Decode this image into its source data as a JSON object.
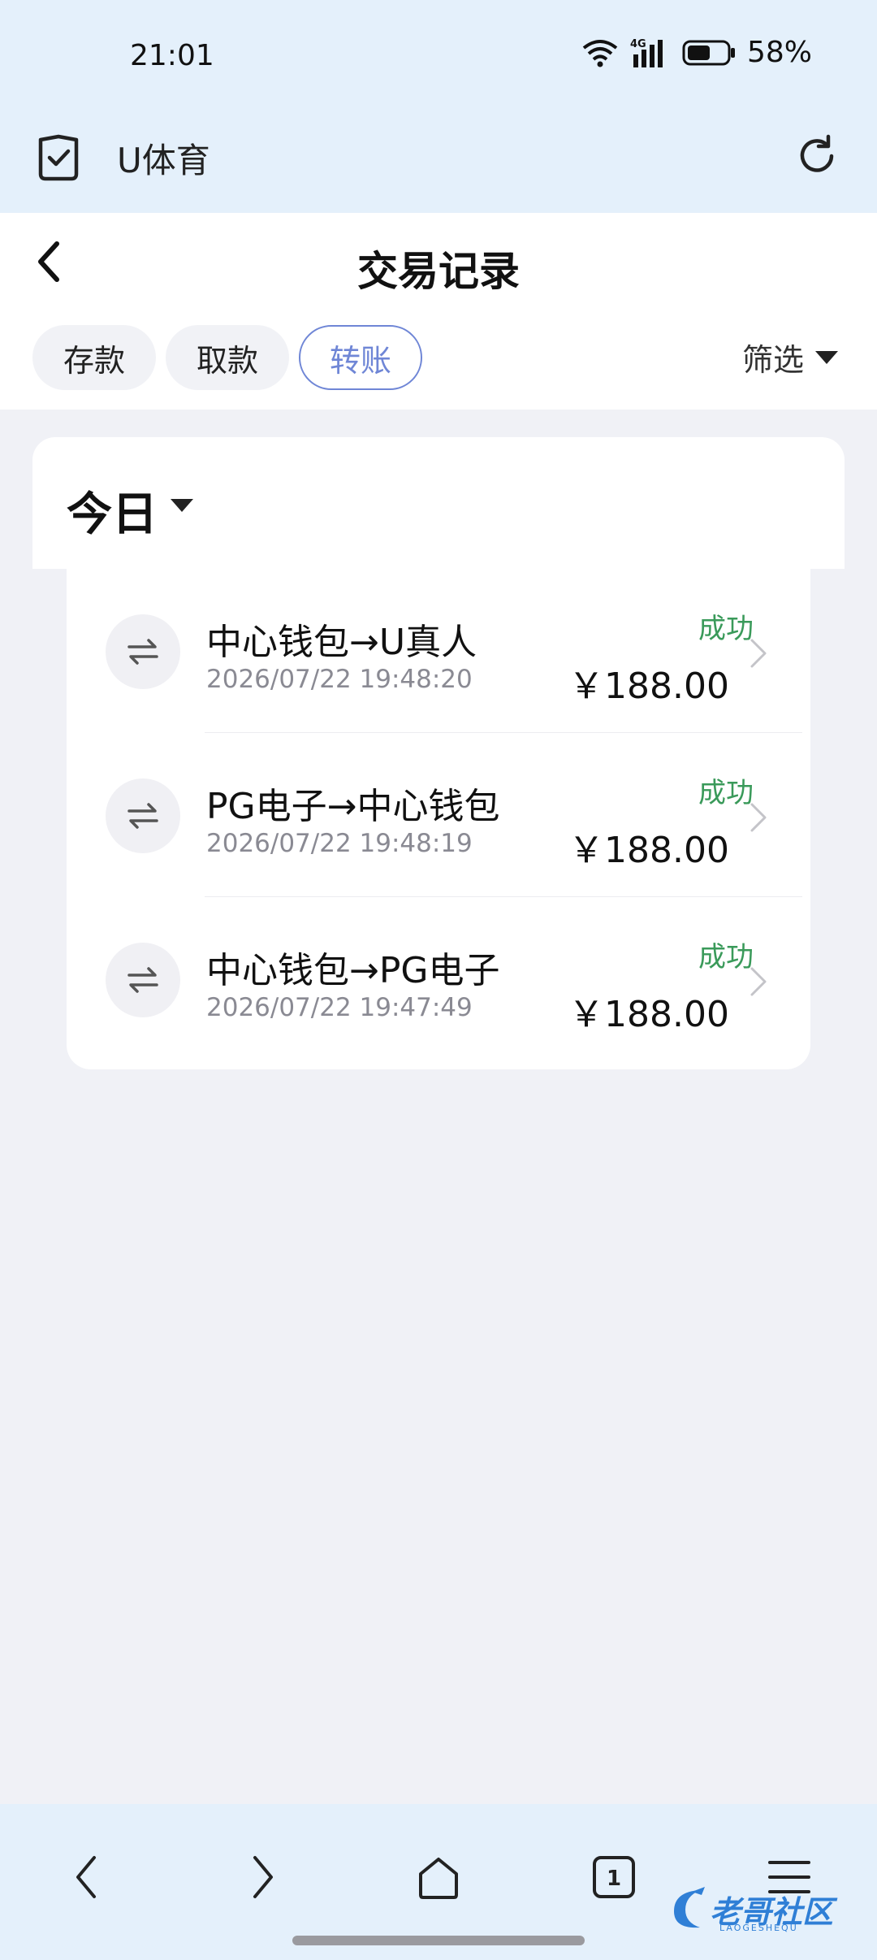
{
  "status_bar": {
    "time": "21:01",
    "network": "4G",
    "battery_pct": "58%",
    "battery_level": 0.58
  },
  "browser": {
    "site_name": "U体育"
  },
  "header": {
    "title": "交易记录",
    "tabs": [
      {
        "label": "存款",
        "active": false
      },
      {
        "label": "取款",
        "active": false
      },
      {
        "label": "转账",
        "active": true
      }
    ],
    "filter_label": "筛选"
  },
  "day_filter": {
    "label": "今日"
  },
  "transactions": [
    {
      "title": "中心钱包→U真人",
      "time": "2026/07/22 19:48:20",
      "status": "成功",
      "amount": "￥188.00"
    },
    {
      "title": "PG电子→中心钱包",
      "time": "2026/07/22 19:48:19",
      "status": "成功",
      "amount": "￥188.00"
    },
    {
      "title": "中心钱包→PG电子",
      "time": "2026/07/22 19:47:49",
      "status": "成功",
      "amount": "￥188.00"
    }
  ],
  "bottom_nav": {
    "tab_count": "1"
  },
  "watermark": {
    "text": "老哥社区",
    "sub": "LAOGESHEQU"
  },
  "colors": {
    "accent": "#6f86d6",
    "success": "#3a9a5a",
    "bar_bg": "#e4f0fb",
    "page_bg": "#f0f1f6"
  }
}
